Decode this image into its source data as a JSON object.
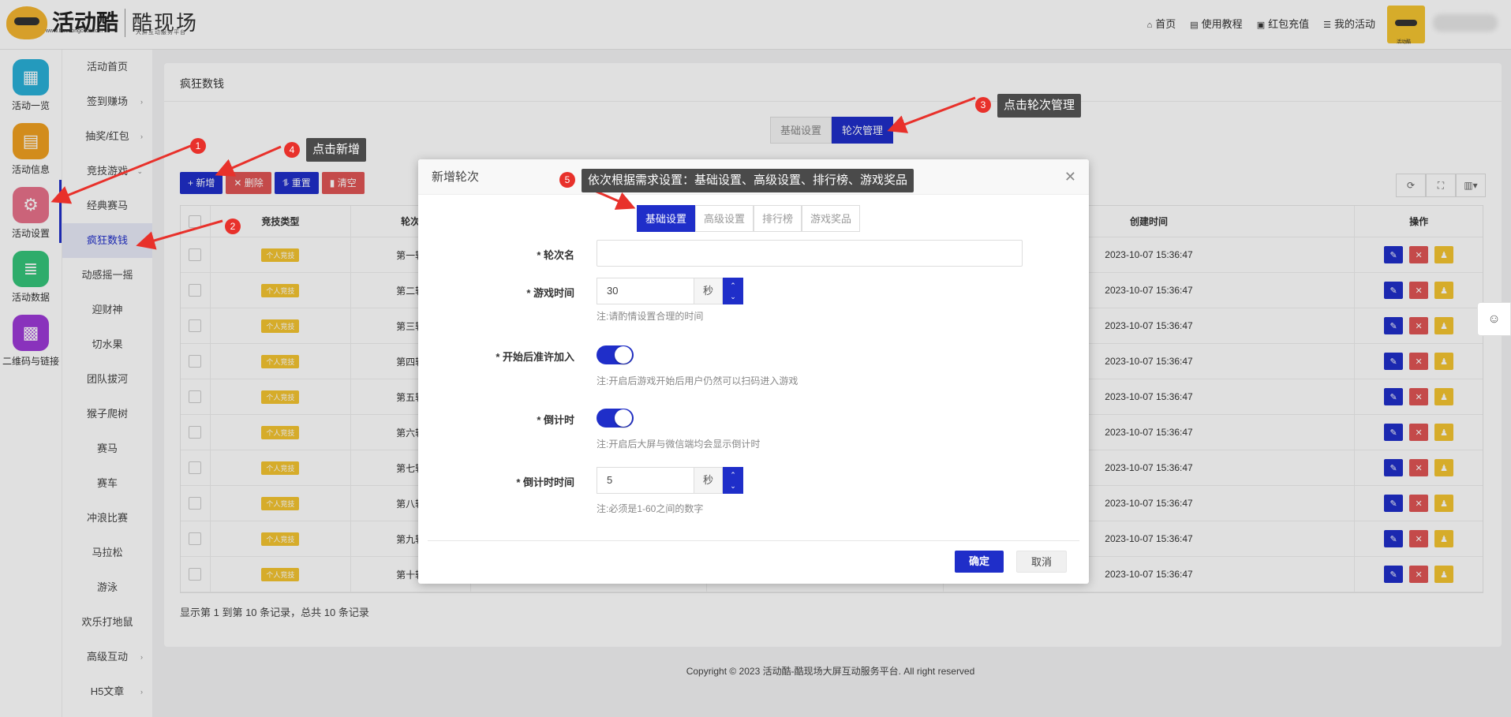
{
  "header": {
    "logo_main": "活动酷",
    "logo_url": "www.huodongcool.com",
    "logo_sub": "酷现场",
    "logo_sub2": "大屏互动服务平台",
    "nav": [
      {
        "label": "首页",
        "icon": "home-icon"
      },
      {
        "label": "使用教程",
        "icon": "book-icon"
      },
      {
        "label": "红包充值",
        "icon": "wallet-icon"
      },
      {
        "label": "我的活动",
        "icon": "list-icon"
      }
    ],
    "avatar_text": "活动酷"
  },
  "sidebar_primary": [
    {
      "label": "活动一览",
      "icon": "grid-icon",
      "color": "#2ab0d8"
    },
    {
      "label": "活动信息",
      "icon": "document-icon",
      "color": "#f0a020"
    },
    {
      "label": "活动设置",
      "icon": "gear-icon",
      "color": "#e8718a"
    },
    {
      "label": "活动数据",
      "icon": "database-icon",
      "color": "#35c47a"
    },
    {
      "label": "二维码与链接",
      "icon": "qrcode-icon",
      "color": "#9d3ad6"
    }
  ],
  "sidebar_secondary": [
    {
      "label": "活动首页",
      "arrow": ""
    },
    {
      "label": "签到赚场",
      "arrow": "›"
    },
    {
      "label": "抽奖/红包",
      "arrow": "›"
    },
    {
      "label": "竞技游戏",
      "arrow": "⌄"
    },
    {
      "label": "经典赛马",
      "arrow": ""
    },
    {
      "label": "疯狂数钱",
      "arrow": ""
    },
    {
      "label": "动感摇一摇",
      "arrow": ""
    },
    {
      "label": "迎财神",
      "arrow": ""
    },
    {
      "label": "切水果",
      "arrow": ""
    },
    {
      "label": "团队拔河",
      "arrow": ""
    },
    {
      "label": "猴子爬树",
      "arrow": ""
    },
    {
      "label": "赛马",
      "arrow": ""
    },
    {
      "label": "赛车",
      "arrow": ""
    },
    {
      "label": "冲浪比赛",
      "arrow": ""
    },
    {
      "label": "马拉松",
      "arrow": ""
    },
    {
      "label": "游泳",
      "arrow": ""
    },
    {
      "label": "欢乐打地鼠",
      "arrow": ""
    },
    {
      "label": "高级互动",
      "arrow": "›"
    },
    {
      "label": "H5文章",
      "arrow": "›"
    }
  ],
  "main": {
    "breadcrumb": "疯狂数钱",
    "tabs": [
      "基础设置",
      "轮次管理"
    ],
    "toolbar": {
      "add": "+ 新增",
      "delete": "✕ 删除",
      "reset": "⥮ 重置",
      "clear": "▮ 清空"
    },
    "table": {
      "headers": {
        "type": "竞技类型",
        "round": "轮次",
        "created": "创建时间",
        "ops": "操作"
      },
      "tag": "个人竞技",
      "rows": [
        {
          "round": "第一轮",
          "created": "2023-10-07 15:36:47"
        },
        {
          "round": "第二轮",
          "created": "2023-10-07 15:36:47"
        },
        {
          "round": "第三轮",
          "created": "2023-10-07 15:36:47"
        },
        {
          "round": "第四轮",
          "created": "2023-10-07 15:36:47"
        },
        {
          "round": "第五轮",
          "created": "2023-10-07 15:36:47"
        },
        {
          "round": "第六轮",
          "created": "2023-10-07 15:36:47"
        },
        {
          "round": "第七轮",
          "created": "2023-10-07 15:36:47"
        },
        {
          "round": "第八轮",
          "created": "2023-10-07 15:36:47"
        },
        {
          "round": "第九轮",
          "created": "2023-10-07 15:36:47"
        },
        {
          "round": "第十轮",
          "created": "2023-10-07 15:36:47"
        }
      ]
    },
    "pager": "显示第 1 到第 10 条记录，总共 10 条记录"
  },
  "footer": "Copyright © 2023 活动酷-酷现场大屏互动服务平台. All right reserved",
  "modal": {
    "title": "新增轮次",
    "tabs": [
      "基础设置",
      "高级设置",
      "排行榜",
      "游戏奖品"
    ],
    "fields": {
      "round_name_label": "* 轮次名",
      "round_name_value": "",
      "game_time_label": "* 游戏时间",
      "game_time_value": "30",
      "game_time_unit": "秒",
      "game_time_hint": "注:请酌情设置合理的时间",
      "allow_join_label": "* 开始后准许加入",
      "allow_join_hint": "注:开启后游戏开始后用户仍然可以扫码进入游戏",
      "countdown_label": "* 倒计时",
      "countdown_hint": "注:开启后大屏与微信端均会显示倒计时",
      "countdown_time_label": "* 倒计时时间",
      "countdown_time_value": "5",
      "countdown_time_unit": "秒",
      "countdown_time_hint": "注:必须是1-60之间的数字"
    },
    "ok": "确定",
    "cancel": "取消"
  },
  "annotations": {
    "a1": "1",
    "a2": "2",
    "a3": "3",
    "a4": "4",
    "a5": "5",
    "t3": "点击轮次管理",
    "t4": "点击新增",
    "t5": "依次根据需求设置：基础设置、高级设置、排行榜、游戏奖品"
  },
  "colors": {
    "accent": "#1f2ec9",
    "danger": "#e05555",
    "warning": "#f4c430",
    "annotation": "#e8312b"
  }
}
